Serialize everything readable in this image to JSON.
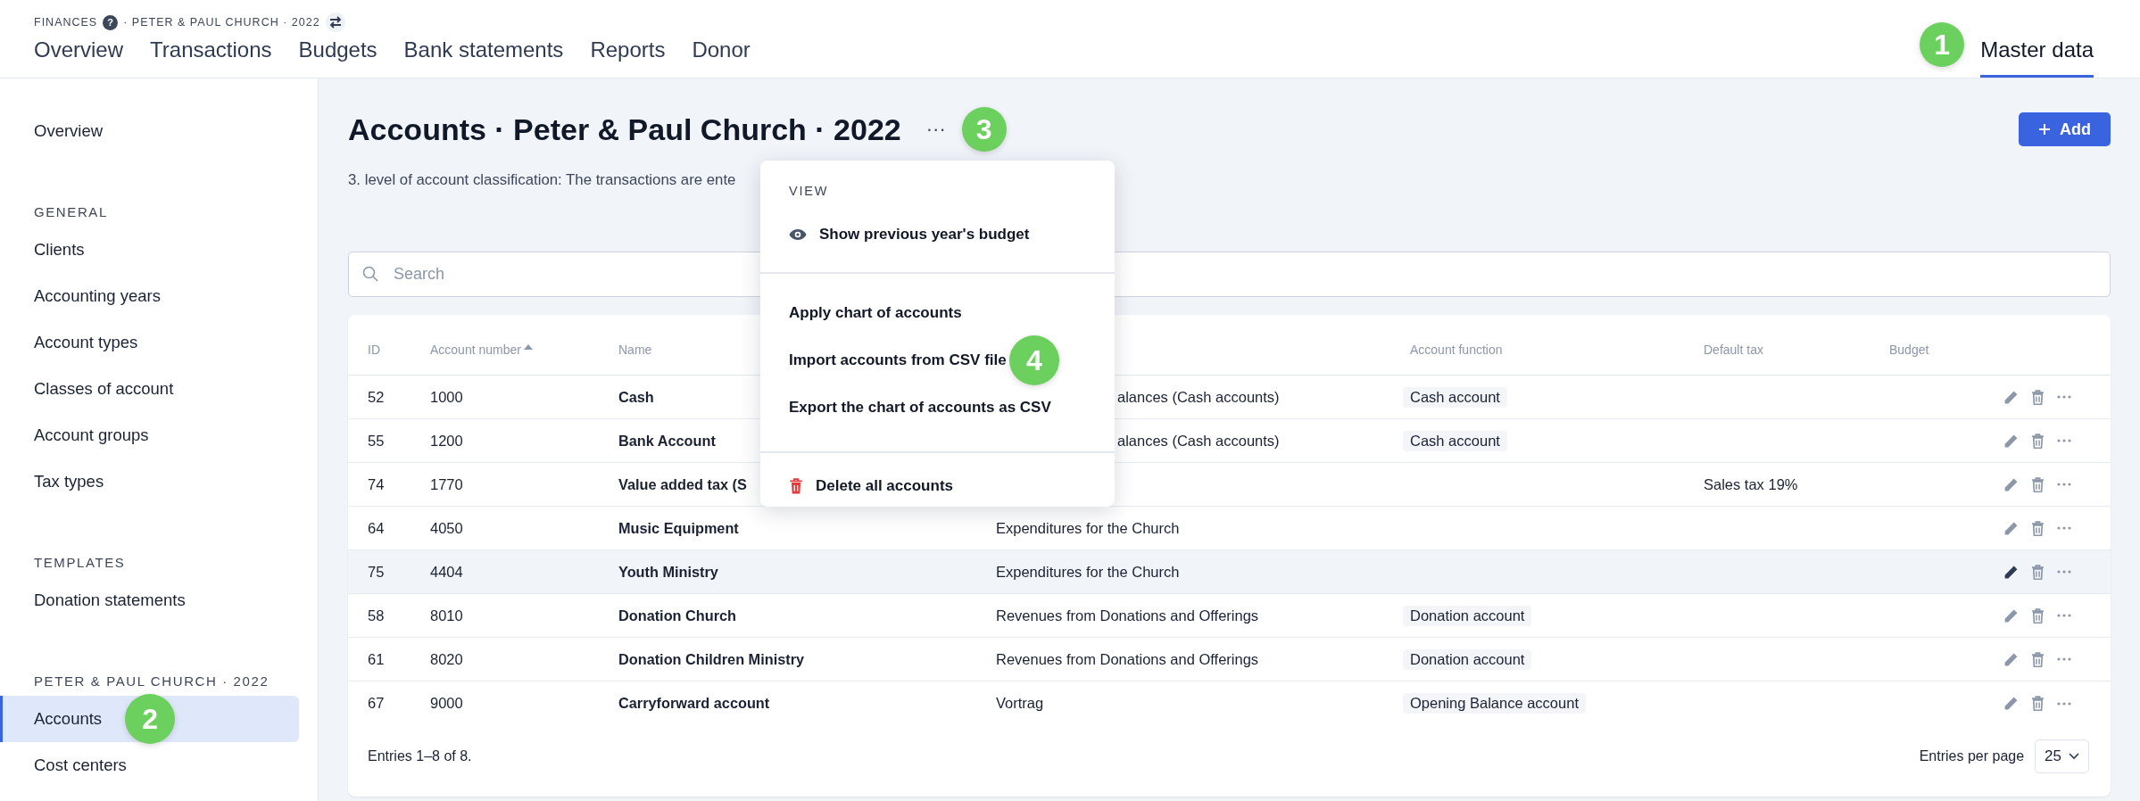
{
  "header": {
    "breadcrumb": {
      "section": "FINANCES",
      "help": "?",
      "context": "· PETER & PAUL CHURCH · 2022"
    },
    "nav": [
      {
        "label": "Overview",
        "selected": false
      },
      {
        "label": "Transactions",
        "selected": false
      },
      {
        "label": "Budgets",
        "selected": false
      },
      {
        "label": "Bank statements",
        "selected": false
      },
      {
        "label": "Reports",
        "selected": false
      },
      {
        "label": "Donor",
        "selected": false
      }
    ],
    "nav_right": {
      "label": "Master data",
      "selected": true,
      "callout": "1"
    }
  },
  "sidebar": {
    "groups": [
      {
        "items": [
          {
            "label": "Overview",
            "selected": false
          }
        ]
      },
      {
        "heading": "GENERAL",
        "items": [
          {
            "label": "Clients",
            "selected": false
          },
          {
            "label": "Accounting years",
            "selected": false
          },
          {
            "label": "Account types",
            "selected": false
          },
          {
            "label": "Classes of account",
            "selected": false
          },
          {
            "label": "Account groups",
            "selected": false
          },
          {
            "label": "Tax types",
            "selected": false
          }
        ]
      },
      {
        "heading": "TEMPLATES",
        "items": [
          {
            "label": "Donation statements",
            "selected": false
          }
        ]
      },
      {
        "heading": "PETER & PAUL CHURCH · 2022",
        "items": [
          {
            "label": "Accounts",
            "selected": true,
            "callout": "2"
          },
          {
            "label": "Cost centers",
            "selected": false
          }
        ]
      }
    ]
  },
  "page": {
    "title": "Accounts · Peter & Paul Church · 2022",
    "more": "···",
    "callout": "3",
    "add_button": "Add",
    "description": "3. level of account classification: The transactions are ente"
  },
  "menu": {
    "sections": [
      {
        "heading": "VIEW",
        "items": [
          {
            "label": "Show previous year's budget",
            "kind": "view"
          }
        ]
      },
      {
        "items": [
          {
            "label": "Apply chart of accounts",
            "kind": "plain"
          },
          {
            "label": "Import accounts from CSV file",
            "kind": "plain",
            "callout": "4"
          },
          {
            "label": "Export the chart of accounts as CSV",
            "kind": "plain"
          }
        ]
      },
      {
        "items": [
          {
            "label": "Delete all accounts",
            "kind": "danger"
          }
        ]
      }
    ]
  },
  "search": {
    "placeholder": "Search"
  },
  "table": {
    "columns": [
      {
        "label": "ID"
      },
      {
        "label": "Account number",
        "sorted": true
      },
      {
        "label": "Name"
      },
      {
        "label": "Account function"
      },
      {
        "label": "Default tax"
      },
      {
        "label": "Budget"
      }
    ],
    "rows": [
      {
        "id": "52",
        "number": "1000",
        "name": "Cash",
        "column_4": {
          "text": "alances (Cash accounts)",
          "partly_covered": true
        },
        "function": "Cash account",
        "hovered": false
      },
      {
        "id": "55",
        "number": "1200",
        "name": "Bank Account",
        "column_4": {
          "text": "alances (Cash accounts)",
          "partly_covered": true
        },
        "function": "Cash account",
        "hovered": false
      },
      {
        "id": "74",
        "number": "1770",
        "name": "Value added tax (S",
        "tax": "Sales tax 19%",
        "hovered": false
      },
      {
        "id": "64",
        "number": "4050",
        "name": "Music Equipment",
        "column_4": {
          "text": "Expenditures for the Church"
        },
        "hovered": false
      },
      {
        "id": "75",
        "number": "4404",
        "name": "Youth Ministry",
        "column_4": {
          "text": "Expenditures for the Church"
        },
        "hovered": true
      },
      {
        "id": "58",
        "number": "8010",
        "name": "Donation Church",
        "column_4": {
          "text": "Revenues from Donations and Offerings"
        },
        "function": "Donation account",
        "hovered": false
      },
      {
        "id": "61",
        "number": "8020",
        "name": "Donation Children Ministry",
        "column_4": {
          "text": "Revenues from Donations and Offerings"
        },
        "function": "Donation account",
        "hovered": false
      },
      {
        "id": "67",
        "number": "9000",
        "name": "Carryforward account",
        "column_4": {
          "text": "Vortrag"
        },
        "function": "Opening Balance account",
        "hovered": false
      }
    ],
    "summary": "Entries 1–8 of 8.",
    "per_page_label": "Entries per page",
    "per_page": "25"
  }
}
